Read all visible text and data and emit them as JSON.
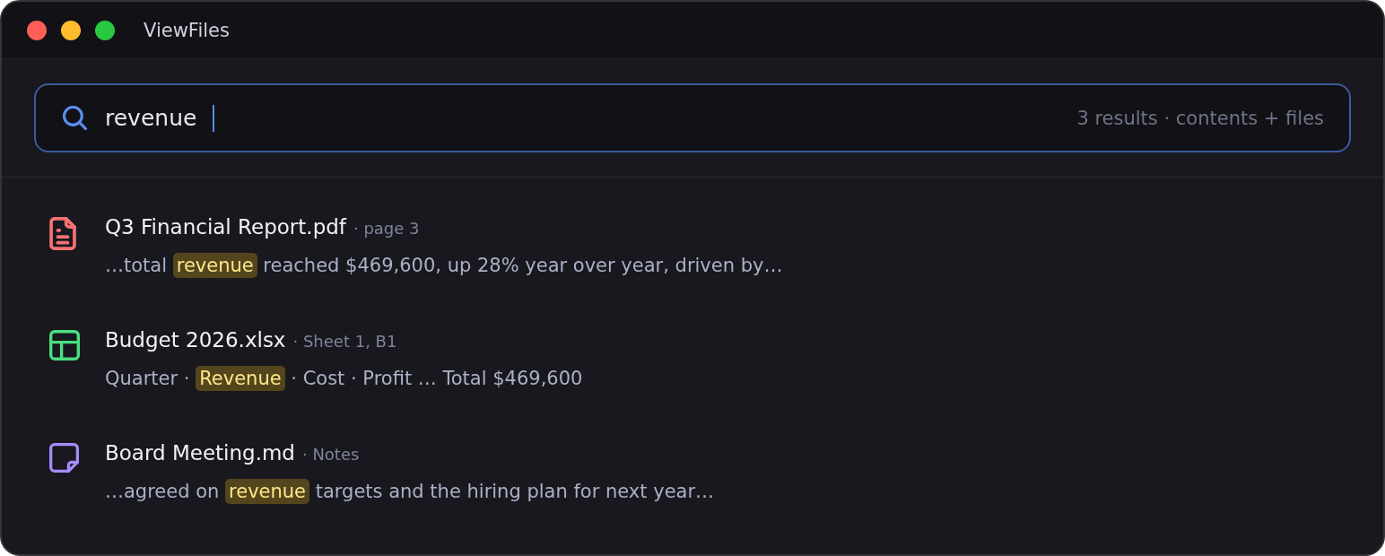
{
  "window": {
    "title": "ViewFiles",
    "controls": [
      {
        "color": "#ff5f57"
      },
      {
        "color": "#febc2e"
      },
      {
        "color": "#28c840"
      }
    ]
  },
  "search": {
    "value": "revenue",
    "focused": true,
    "summary": "3 results · contents + files"
  },
  "results": [
    {
      "kind": "pdf",
      "color": "#f87171",
      "name": "Q3 Financial Report.pdf",
      "location": "· page 3",
      "snippet": [
        {
          "text": "…total ",
          "highlight": false
        },
        {
          "text": "revenue",
          "highlight": true
        },
        {
          "text": " reached $469,600, up 28% year over year, driven by…",
          "highlight": false
        }
      ]
    },
    {
      "kind": "spreadsheet",
      "color": "#4ade80",
      "name": "Budget 2026.xlsx",
      "location": "· Sheet 1, B1",
      "snippet": [
        {
          "text": "Quarter · ",
          "highlight": false
        },
        {
          "text": "Revenue",
          "highlight": true
        },
        {
          "text": " · Cost · Profit … Total $469,600",
          "highlight": false
        }
      ]
    },
    {
      "kind": "note",
      "color": "#a78bfa",
      "name": "Board Meeting.md",
      "location": "· Notes",
      "snippet": [
        {
          "text": "…agreed on ",
          "highlight": false
        },
        {
          "text": "revenue",
          "highlight": true
        },
        {
          "text": " targets and the hiring plan for next year…",
          "highlight": false
        }
      ]
    }
  ]
}
